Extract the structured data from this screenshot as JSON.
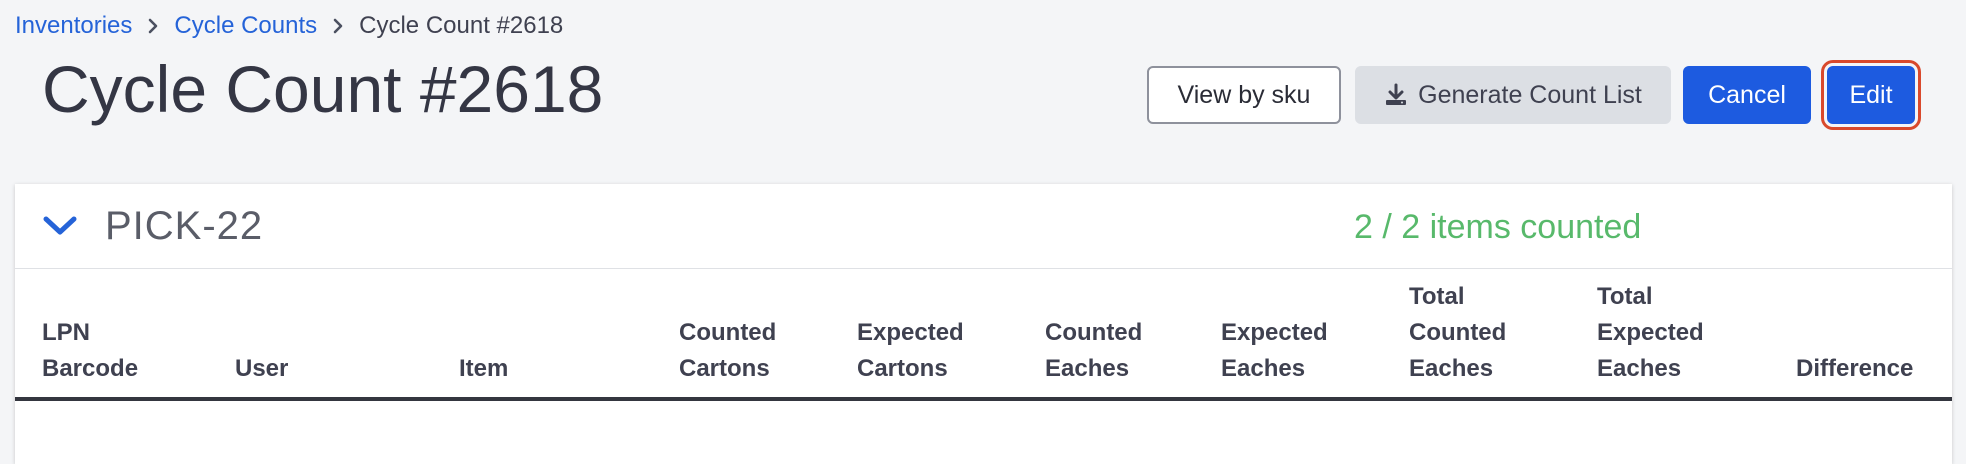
{
  "breadcrumb": {
    "items": [
      "Inventories",
      "Cycle Counts"
    ],
    "current": "Cycle Count #2618"
  },
  "page": {
    "title": "Cycle Count #2618"
  },
  "actions": {
    "view_by_sku": "View by sku",
    "generate_count_list": "Generate Count List",
    "cancel": "Cancel",
    "edit": "Edit"
  },
  "location": {
    "name": "PICK-22",
    "status": "2 / 2 items counted"
  },
  "table": {
    "columns": [
      [
        "LPN",
        "Barcode"
      ],
      [
        "User"
      ],
      [
        "Item"
      ],
      [
        "Counted",
        "Cartons"
      ],
      [
        "Expected",
        "Cartons"
      ],
      [
        "Counted",
        "Eaches"
      ],
      [
        "Expected",
        "Eaches"
      ],
      [
        "Total",
        "Counted",
        "Eaches"
      ],
      [
        "Total",
        "Expected",
        "Eaches"
      ],
      [
        "Difference"
      ]
    ]
  },
  "colors": {
    "primary": "#1d5be0",
    "link": "#2563d8",
    "success": "#58b96b",
    "highlight": "#d9492c"
  },
  "icons": {
    "breadcrumb_separator": "chevron-right-icon",
    "download": "download-icon",
    "collapse": "chevron-down-icon"
  }
}
